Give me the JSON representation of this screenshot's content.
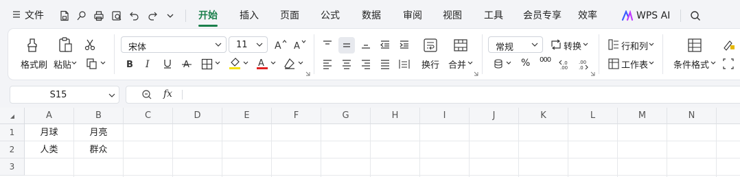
{
  "menubar": {
    "file_label": "文件",
    "tabs": [
      "开始",
      "插入",
      "页面",
      "公式",
      "数据",
      "审阅",
      "视图",
      "工具",
      "会员专享",
      "效率"
    ],
    "active_tab": "开始",
    "wps_ai_label": "WPS AI"
  },
  "ribbon": {
    "clipboard": {
      "format_painter": "格式刷",
      "paste": "粘贴"
    },
    "font": {
      "name": "宋体",
      "size": "11"
    },
    "alignment": {
      "wrap": "换行",
      "merge": "合并"
    },
    "number": {
      "format": "常规",
      "convert": "转换",
      "percent": "%",
      "thousands": "000"
    },
    "cells": {
      "row_col": "行和列",
      "worksheet": "工作表",
      "cond_format": "条件格式"
    }
  },
  "formula_bar": {
    "cell_ref": "S15",
    "fx": "fx",
    "value": ""
  },
  "sheet": {
    "columns": [
      "A",
      "B",
      "C",
      "D",
      "E",
      "F",
      "G",
      "H",
      "I",
      "J",
      "K",
      "L",
      "M",
      "N"
    ],
    "rows": [
      {
        "num": "1",
        "cells": [
          "月球",
          "月亮"
        ]
      },
      {
        "num": "2",
        "cells": [
          "人类",
          "群众"
        ]
      },
      {
        "num": "3",
        "cells": [
          "",
          ""
        ]
      }
    ]
  },
  "colors": {
    "accent": "#1a7f4b",
    "highlight": "#f5e000",
    "font_red": "#e02020"
  }
}
